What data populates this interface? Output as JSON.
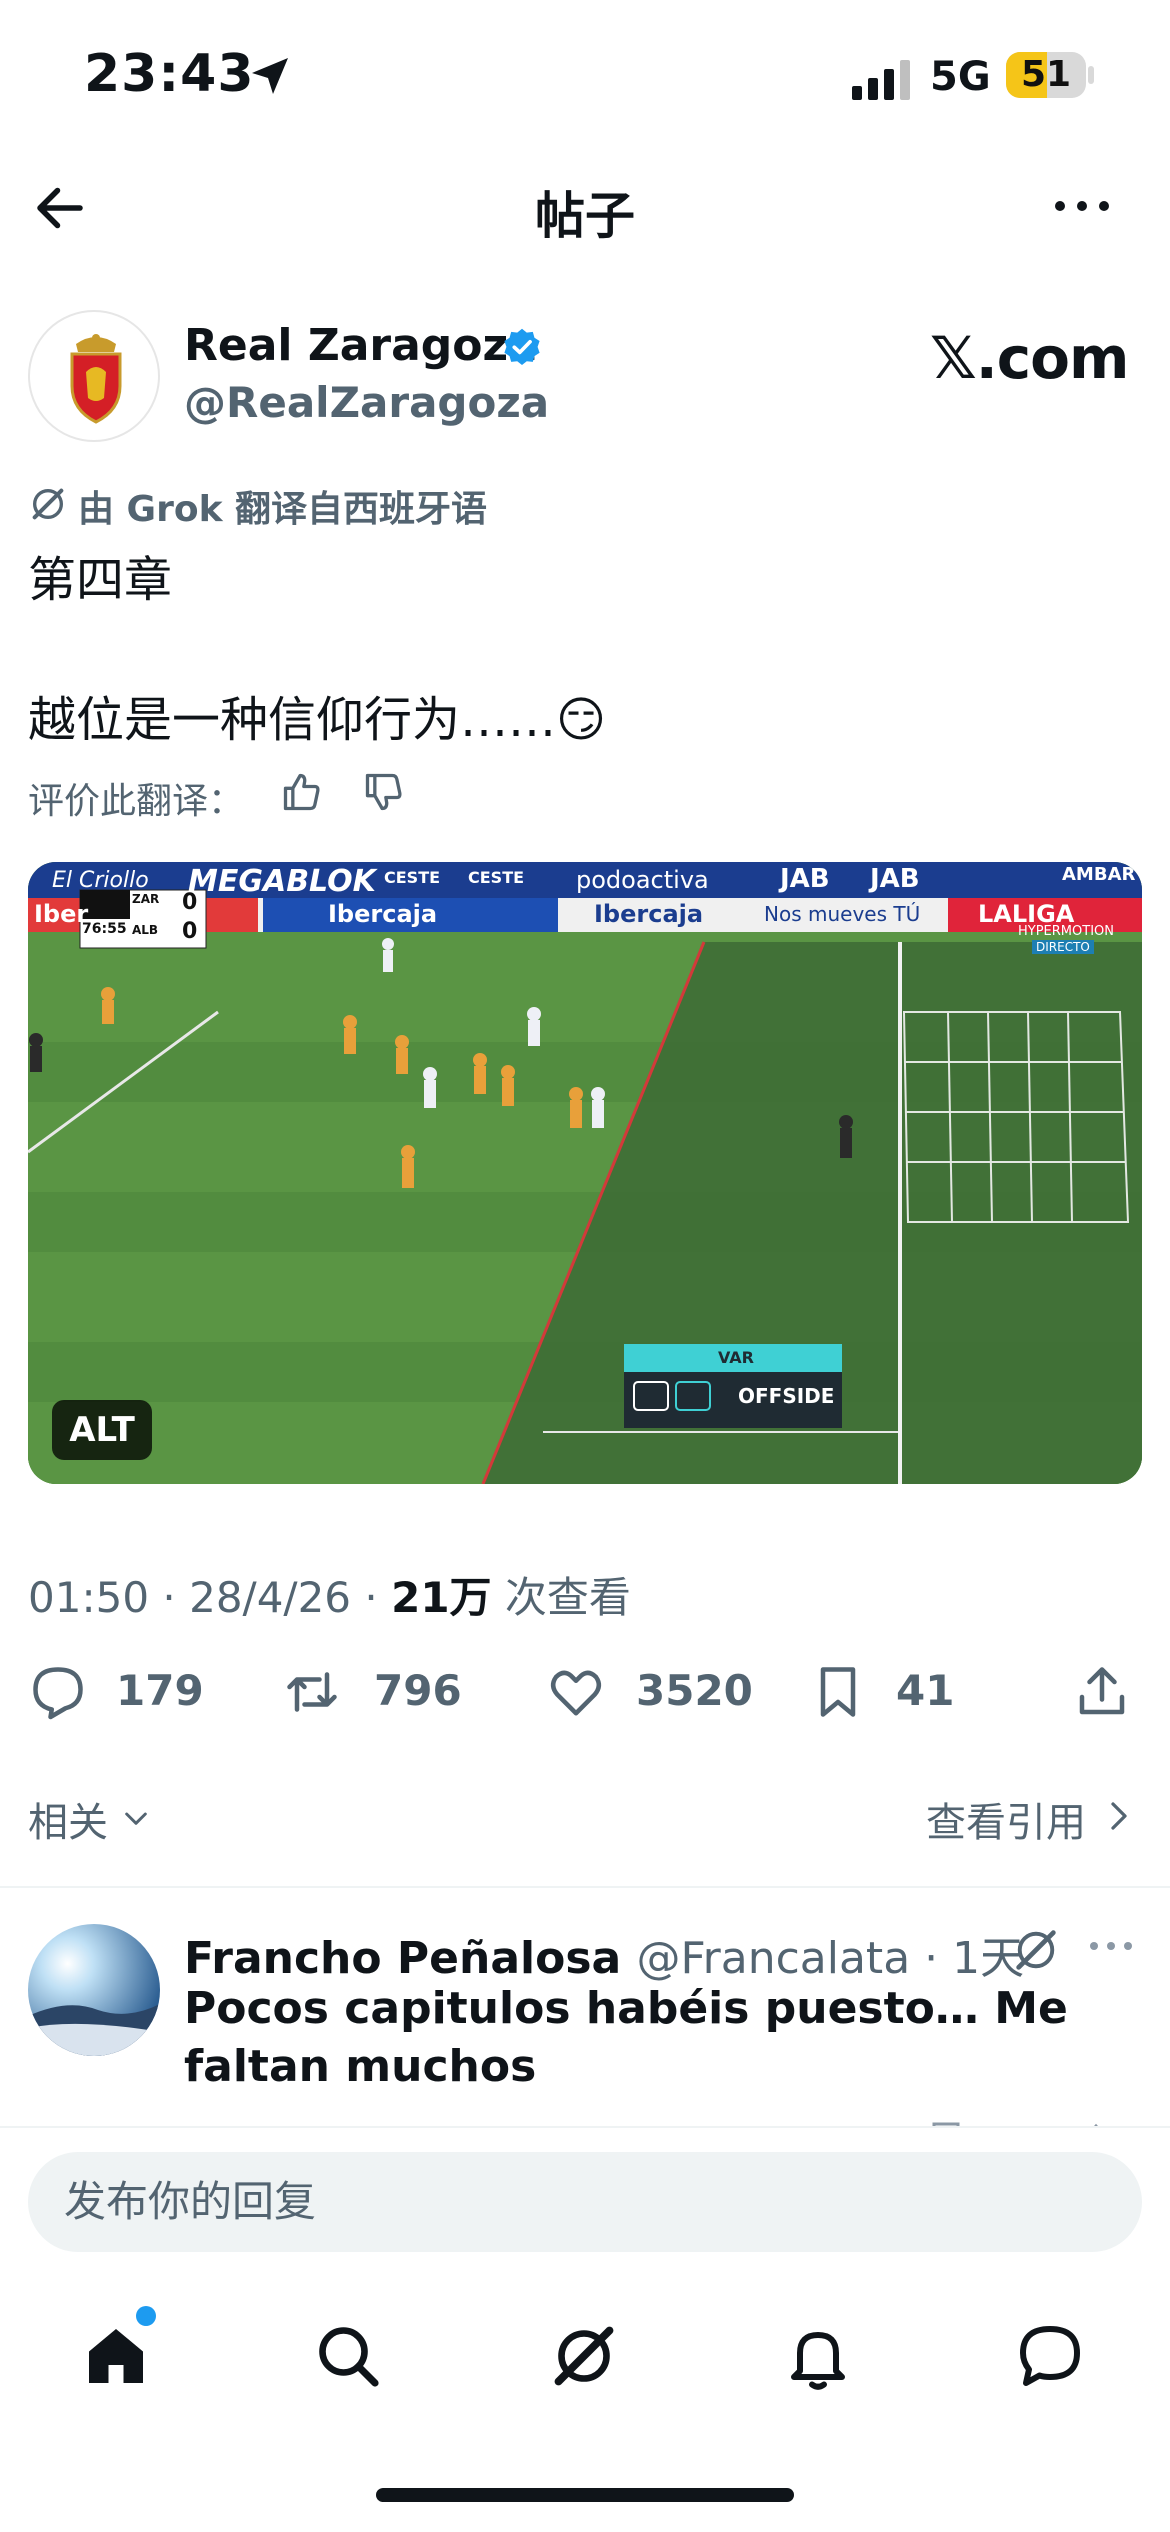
{
  "status_bar": {
    "time": "23:43",
    "network": "5G",
    "battery": "51",
    "battery_level": 0.51
  },
  "header": {
    "title": "帖子"
  },
  "post": {
    "author_name": "Real Zaragoza",
    "author_handle": "@RealZaragoza",
    "source_label": "𝕏.com",
    "translation_note": "由 Grok 翻译自西班牙语",
    "text_line1": "第四章",
    "text_line2": "越位是一种信仰行为……😏",
    "rate_translation_label": "评价此翻译：",
    "media": {
      "alt_label": "ALT",
      "ad_boards": [
        "El Criollo",
        "MEGABLOK",
        "CESTE",
        "CESTE",
        "podoactiva",
        "JAB",
        "JAB",
        "AMBAR"
      ],
      "ad_boards_lower": [
        "Iber",
        "Ibercaja",
        "Ibercaja",
        "Nos mueves TÚ",
        "LALIGA"
      ],
      "score": {
        "time": "76:55",
        "home": "ZAR",
        "away": "ALB",
        "home_score": "0",
        "away_score": "0"
      },
      "hypermotion": "HYPERMOTION",
      "directo": "DIRECTO",
      "var_title": "VAR",
      "var_decision": "OFFSIDE"
    },
    "meta": {
      "time": "01:50",
      "date": "28/4/26",
      "views": "21万",
      "views_suffix": "次查看"
    },
    "actions": {
      "replies": "179",
      "reposts": "796",
      "likes": "3520",
      "bookmarks": "41"
    },
    "related_label": "相关",
    "quotes_label": "查看引用"
  },
  "reply": {
    "author_name": "Francho Peñalosa",
    "author_handle": "@Francalata",
    "time": "1天",
    "text": "Pocos capitulos habéis puesto… Me faltan muchos"
  },
  "composer": {
    "placeholder": "发布你的回复"
  },
  "colors": {
    "accent": "#1d9bf0",
    "text": "#0f1419",
    "muted": "#536471",
    "pitch": "#4f8a3c"
  },
  "tab_bar": [
    "home-icon",
    "search-icon",
    "grok-icon",
    "bell-icon",
    "messages-icon"
  ]
}
